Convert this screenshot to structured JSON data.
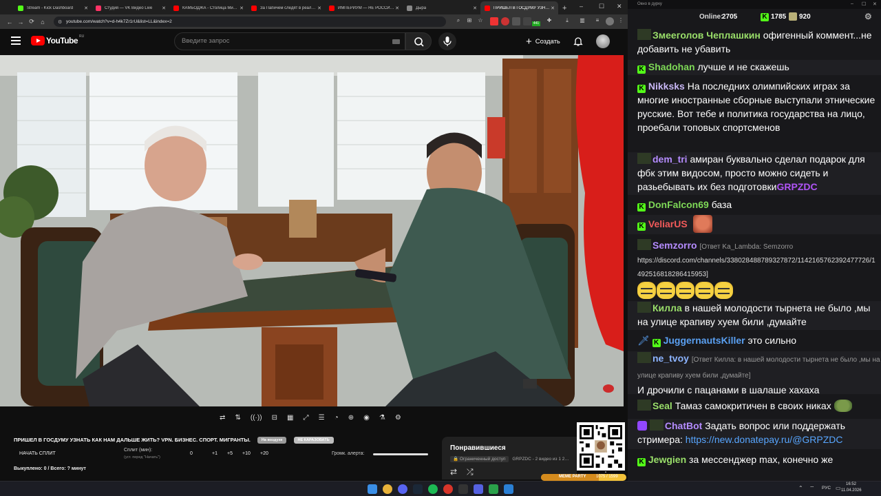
{
  "browser": {
    "tabs": [
      {
        "label": "Stream - Kick Dashboard",
        "color": "#53fc18"
      },
      {
        "label": "Студия — VK Видео Live",
        "color": "#ff3366"
      },
      {
        "label": "КАМБОДЖА - Столица Ми…",
        "color": "#ff0000"
      },
      {
        "label": "За Папичем следят в реал…",
        "color": "#ff0000"
      },
      {
        "label": "ИМПЕРИУМ — НЕ РОССИЯ…",
        "color": "#ff0000"
      },
      {
        "label": "Дыра",
        "color": "#888888"
      },
      {
        "label": "ПРИШЕЛ В ГОСДУМУ УЗНАТ…",
        "color": "#ff0000"
      }
    ],
    "url": "youtube.com/watch?v=d-h4k7Zr1rU&list=LL&index=2",
    "ext_badge": "441"
  },
  "youtube": {
    "logo_text": "YouTube",
    "region": "RU",
    "search_placeholder": "Введите запрос",
    "create_label": "Создать"
  },
  "player_controls": [
    "repeat-icon",
    "sort-icon",
    "cast-icon",
    "theater-icon",
    "film-icon",
    "expand-icon",
    "captions-icon",
    "speed-icon",
    "clip-icon",
    "camera-icon",
    "lab-icon",
    "settings-icon"
  ],
  "stream_panel": {
    "title": "ПРИШЕЛ В ГОСДУМУ УЗНАТЬ КАК НАМ ДАЛЬШЕ ЖИТЬ? VPN. БИЗНЕС. СПОРТ. МИГРАНТЫ.",
    "btn_on_air": "На воздухе",
    "btn_clear": "НЕ КАРАЗОВАТЬ",
    "start_split": "НАЧАТЬ СПЛИТ",
    "split_label": "Сплит (мин):",
    "split_hint": "(уст. перед \"Начать\")",
    "split_values": [
      "0",
      "+1",
      "+5",
      "+10",
      "+20"
    ],
    "alert_volume_label": "Громк. алерта:",
    "alert_volume": 0.95,
    "bought": "Выкуплено: 0 / Всего: ? минут"
  },
  "playlist": {
    "title": "Понравившиеся",
    "access": "Ограниченный доступ",
    "meta": "GRPZDC - 2 видео из 1 2…"
  },
  "overlay": {
    "meme_party": "MEME PARTY",
    "progress_text": "1075 / 1599"
  },
  "chat": {
    "window_title": "Окно в дурку",
    "online_label": "Online:",
    "online": "2705",
    "kick_count": "1785",
    "other_count": "920",
    "messages": [
      {
        "user": "Змееголов Чеплашкин",
        "color": "#9adf6a",
        "badge": "avatar",
        "text": "офигенный коммент...не добавить не убавить"
      },
      {
        "user": "Shadohan",
        "color": "#7ed957",
        "badge": "kick",
        "text": "лучше и не скажешь"
      },
      {
        "user": "Nikksks",
        "color": "#c8b7f5",
        "badge": "kick",
        "text": "На последних олимпийских играх за многие иностранные сборные выступали этнические русские. Вот тебе и политика государства на лицо, проебали топовых спортсменов"
      },
      {
        "user": "dem_tri",
        "color": "#b58cff",
        "badge": "avatar",
        "text": "амиран буквально сделал подарок для фбк этим видосом, просто можно сидеть и разьебывать их без подготовки",
        "tag": "GRPZDC",
        "tag_color": "#b054f7"
      },
      {
        "user": "DonFalcon69",
        "color": "#7ed957",
        "badge": "kick",
        "text": "база"
      },
      {
        "user": "VeliarUS",
        "color": "#f25a5a",
        "badge": "kick",
        "text": ""
      },
      {
        "user": "Semzorro",
        "color": "#b58cff",
        "badge": "avatar",
        "reply": "[Ответ Ka_Lambda: Semzorro",
        "link": "https://discord.com/channels/338028488789327872/1142165762392477726/1492516818286415953]"
      },
      {
        "user": "Килла",
        "color": "#9adf6a",
        "badge": "avatar",
        "text": "в нашей молодости тырнета не было ,мы на улице крапиву хуем били ,думайте"
      },
      {
        "user": "JuggernautsKiller",
        "color": "#5aa0f2",
        "badge": "kick",
        "text": "это сильно"
      },
      {
        "user": "ne_tvoy",
        "color": "#8cb4ff",
        "badge": "avatar",
        "reply": "[Ответ Килла: в нашей молодости тырнета не было ,мы на улице крапиву хуем били ,думайте]",
        "text": "И дрочили с пацанами в шалаше хахаха"
      },
      {
        "user": "Seal",
        "color": "#9adf6a",
        "badge": "avatar",
        "text": "Тамаз самокритичен в своих никах"
      },
      {
        "user": "ChatBot",
        "color": "#b58cff",
        "badge": "bot",
        "text": "Задать вопрос или поддержать стримера:",
        "link": "https://new.donatepay.ru/@GRPZDC",
        "link_color": "#58a6ff"
      },
      {
        "user": "Jewgien",
        "color": "#9adf6a",
        "badge": "kick",
        "text": "за мессенджер max, конечно же"
      }
    ]
  },
  "taskbar": {
    "lang": "РУС",
    "time": "16:52",
    "date": "11.04.2026"
  }
}
